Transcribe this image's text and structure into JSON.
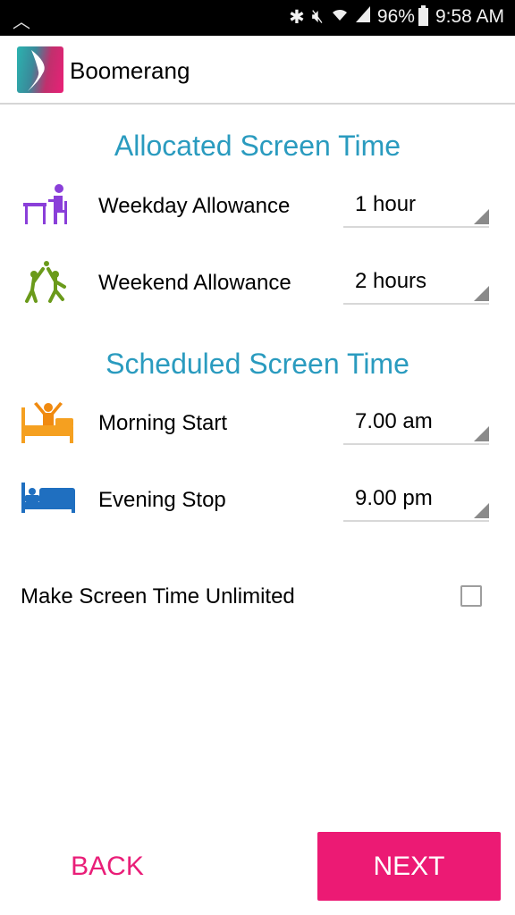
{
  "status_bar": {
    "battery": "96%",
    "time": "9:58 AM",
    "icons": [
      "bluetooth-icon",
      "mute-icon",
      "wifi-icon",
      "signal-icon",
      "battery-icon"
    ]
  },
  "app_bar": {
    "title": "Boomerang",
    "logo": "boomerang-logo"
  },
  "allocated": {
    "title": "Allocated Screen Time",
    "rows": [
      {
        "label": "Weekday Allowance",
        "value": "1 hour",
        "icon": "study-desk-icon",
        "icon_color": "#8a3fd9"
      },
      {
        "label": "Weekend Allowance",
        "value": "2 hours",
        "icon": "kids-playing-icon",
        "icon_color": "#6a9a1a"
      }
    ]
  },
  "scheduled": {
    "title": "Scheduled Screen Time",
    "rows": [
      {
        "label": "Morning Start",
        "value": "7.00 am",
        "icon": "wake-up-bed-icon",
        "icon_color": "#f5a020"
      },
      {
        "label": "Evening Stop",
        "value": "9.00 pm",
        "icon": "sleeping-bed-icon",
        "icon_color": "#1f6fc0"
      }
    ]
  },
  "unlimited": {
    "label": "Make Screen Time Unlimited",
    "checked": false
  },
  "buttons": {
    "back": "BACK",
    "next": "NEXT"
  },
  "colors": {
    "accent": "#ec1a74",
    "section_title": "#2a9bbf"
  }
}
